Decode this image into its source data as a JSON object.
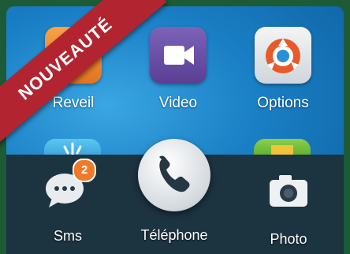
{
  "ribbon": {
    "text": "NOUVEAUTÉ",
    "color": "#b32431"
  },
  "apps": [
    {
      "label": "Reveil",
      "icon": "alarm-icon",
      "color": "#f08a2e"
    },
    {
      "label": "Video",
      "icon": "video-camera-icon",
      "color": "#6a4fa5"
    },
    {
      "label": "Options",
      "icon": "settings-icon",
      "color": "#e85a2a"
    }
  ],
  "dock": {
    "sms": {
      "label": "Sms",
      "badge": "2",
      "icon": "chat-bubble-icon"
    },
    "phone": {
      "label": "Téléphone",
      "icon": "phone-handset-icon"
    },
    "photo": {
      "label": "Photo",
      "icon": "camera-icon"
    }
  }
}
